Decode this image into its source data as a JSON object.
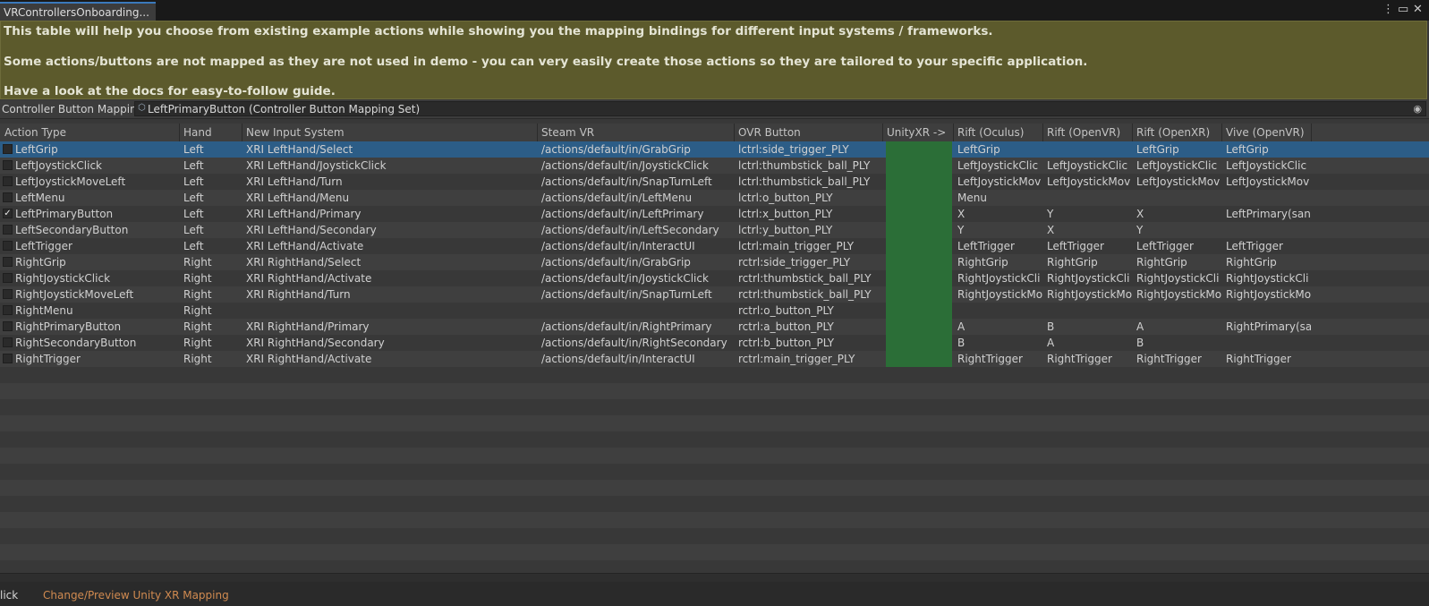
{
  "window": {
    "tab_title": "VRControllersOnboarding...",
    "menu_icon": "kebab-menu-icon",
    "maximize_icon": "maximize-icon",
    "close_icon": "close-icon"
  },
  "info": {
    "line1": "This table will help you choose from existing example actions while showing you the mapping bindings for different input systems / frameworks.",
    "line2": "Some actions/buttons are not mapped as they are not used in demo - you can very easily create those actions so they are tailored to your specific application.",
    "line3": "Have a look at the docs for easy-to-follow guide."
  },
  "mapping_set": {
    "label": "Controller Button Mapping",
    "value": "LeftPrimaryButton (Controller Button Mapping Set)",
    "object_icon": "scriptable-object-icon",
    "picker_icon": "object-picker-icon"
  },
  "table": {
    "columns": [
      "Action Type",
      "Hand",
      "New Input System",
      "Steam VR",
      "OVR Button",
      "UnityXR ->",
      "Rift (Oculus)",
      "Rift (OpenVR)",
      "Rift (OpenXR)",
      "Vive (OpenVR)"
    ],
    "rows": [
      {
        "checked": false,
        "selected": true,
        "cells": [
          "LeftGrip",
          "Left",
          "XRI LeftHand/Select",
          "/actions/default/in/GrabGrip",
          "lctrl:side_trigger_PLY",
          "",
          "LeftGrip",
          "",
          "LeftGrip",
          "LeftGrip"
        ]
      },
      {
        "checked": false,
        "selected": false,
        "cells": [
          "LeftJoystickClick",
          "Left",
          "XRI LeftHand/JoystickClick",
          "/actions/default/in/JoystickClick",
          "lctrl:thumbstick_ball_PLY",
          "",
          "LeftJoystickClic",
          "LeftJoystickClic",
          "LeftJoystickClic",
          "LeftJoystickClic"
        ]
      },
      {
        "checked": false,
        "selected": false,
        "cells": [
          "LeftJoystickMoveLeft",
          "Left",
          "XRI LeftHand/Turn",
          "/actions/default/in/SnapTurnLeft",
          "lctrl:thumbstick_ball_PLY",
          "",
          "LeftJoystickMov",
          "LeftJoystickMov",
          "LeftJoystickMov",
          "LeftJoystickMov"
        ]
      },
      {
        "checked": false,
        "selected": false,
        "cells": [
          "LeftMenu",
          "Left",
          "XRI LeftHand/Menu",
          "/actions/default/in/LeftMenu",
          "lctrl:o_button_PLY",
          "",
          "Menu",
          "",
          "",
          ""
        ]
      },
      {
        "checked": true,
        "selected": false,
        "cells": [
          "LeftPrimaryButton",
          "Left",
          "XRI LeftHand/Primary",
          "/actions/default/in/LeftPrimary",
          "lctrl:x_button_PLY",
          "",
          "X",
          "Y",
          "X",
          "LeftPrimary(sanc"
        ]
      },
      {
        "checked": false,
        "selected": false,
        "cells": [
          "LeftSecondaryButton",
          "Left",
          "XRI LeftHand/Secondary",
          "/actions/default/in/LeftSecondary",
          "lctrl:y_button_PLY",
          "",
          "Y",
          "X",
          "Y",
          ""
        ]
      },
      {
        "checked": false,
        "selected": false,
        "cells": [
          "LeftTrigger",
          "Left",
          "XRI LeftHand/Activate",
          "/actions/default/in/InteractUI",
          "lctrl:main_trigger_PLY",
          "",
          "LeftTrigger",
          "LeftTrigger",
          "LeftTrigger",
          "LeftTrigger"
        ]
      },
      {
        "checked": false,
        "selected": false,
        "cells": [
          "RightGrip",
          "Right",
          "XRI RightHand/Select",
          "/actions/default/in/GrabGrip",
          "rctrl:side_trigger_PLY",
          "",
          "RightGrip",
          "RightGrip",
          "RightGrip",
          "RightGrip"
        ]
      },
      {
        "checked": false,
        "selected": false,
        "cells": [
          "RightJoystickClick",
          "Right",
          "XRI RightHand/Activate",
          "/actions/default/in/JoystickClick",
          "rctrl:thumbstick_ball_PLY",
          "",
          "RightJoystickCli",
          "RightJoystickCli",
          "RightJoystickCli",
          "RightJoystickCli"
        ]
      },
      {
        "checked": false,
        "selected": false,
        "cells": [
          "RightJoystickMoveLeft",
          "Right",
          "XRI RightHand/Turn",
          "/actions/default/in/SnapTurnLeft",
          "rctrl:thumbstick_ball_PLY",
          "",
          "RightJoystickMo",
          "RightJoystickMo",
          "RightJoystickMo",
          "RightJoystickMo"
        ]
      },
      {
        "checked": false,
        "selected": false,
        "cells": [
          "RightMenu",
          "Right",
          "",
          "",
          "rctrl:o_button_PLY",
          "",
          "",
          "",
          "",
          ""
        ]
      },
      {
        "checked": false,
        "selected": false,
        "cells": [
          "RightPrimaryButton",
          "Right",
          "XRI RightHand/Primary",
          "/actions/default/in/RightPrimary",
          "rctrl:a_button_PLY",
          "",
          "A",
          "B",
          "A",
          "RightPrimary(sar"
        ]
      },
      {
        "checked": false,
        "selected": false,
        "cells": [
          "RightSecondaryButton",
          "Right",
          "XRI RightHand/Secondary",
          "/actions/default/in/RightSecondary",
          "rctrl:b_button_PLY",
          "",
          "B",
          "A",
          "B",
          ""
        ]
      },
      {
        "checked": false,
        "selected": false,
        "cells": [
          "RightTrigger",
          "Right",
          "XRI RightHand/Activate",
          "/actions/default/in/InteractUI",
          "rctrl:main_trigger_PLY",
          "",
          "RightTrigger",
          "RightTrigger",
          "RightTrigger",
          "RightTrigger"
        ]
      }
    ],
    "empty_rows": 13,
    "unityxr_column_color": "#2b6e37",
    "selection_color": "#2c5d87"
  },
  "bottom": {
    "prefix": "lick",
    "link_text": "Change/Preview Unity XR Mapping"
  }
}
